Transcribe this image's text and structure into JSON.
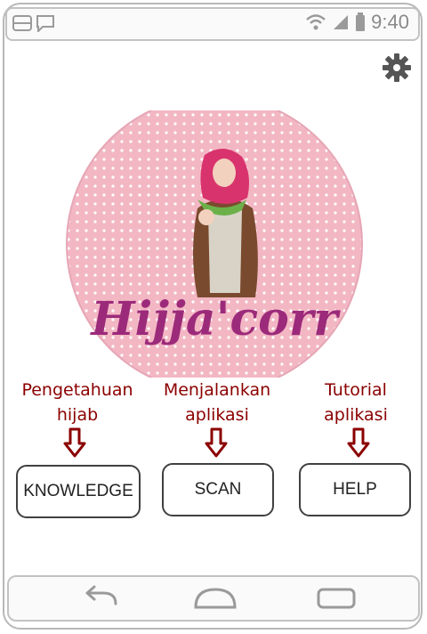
{
  "status_bar": {
    "time": "9:40",
    "icons": [
      "sim-card-icon",
      "message-icon",
      "wifi-icon",
      "signal-icon",
      "battery-icon"
    ]
  },
  "settings_icon": "gear-icon",
  "logo": {
    "text": "Hijja'corr",
    "colors": {
      "circle": "#f5bcc8",
      "dots": "#ffffff",
      "text": "#9c2a7a"
    }
  },
  "actions": [
    {
      "hint_line1": "Pengetahuan",
      "hint_line2": "hijab",
      "button_label": "KNOWLEDGE"
    },
    {
      "hint_line1": "Menjalankan",
      "hint_line2": "aplikasi",
      "button_label": "SCAN"
    },
    {
      "hint_line1": "Tutorial",
      "hint_line2": "aplikasi",
      "button_label": "HELP"
    }
  ],
  "nav_bar": {
    "back": "back-icon",
    "home": "home-icon",
    "recents": "recents-icon"
  },
  "colors": {
    "hint": "#8b0000",
    "button_border": "#404040"
  }
}
